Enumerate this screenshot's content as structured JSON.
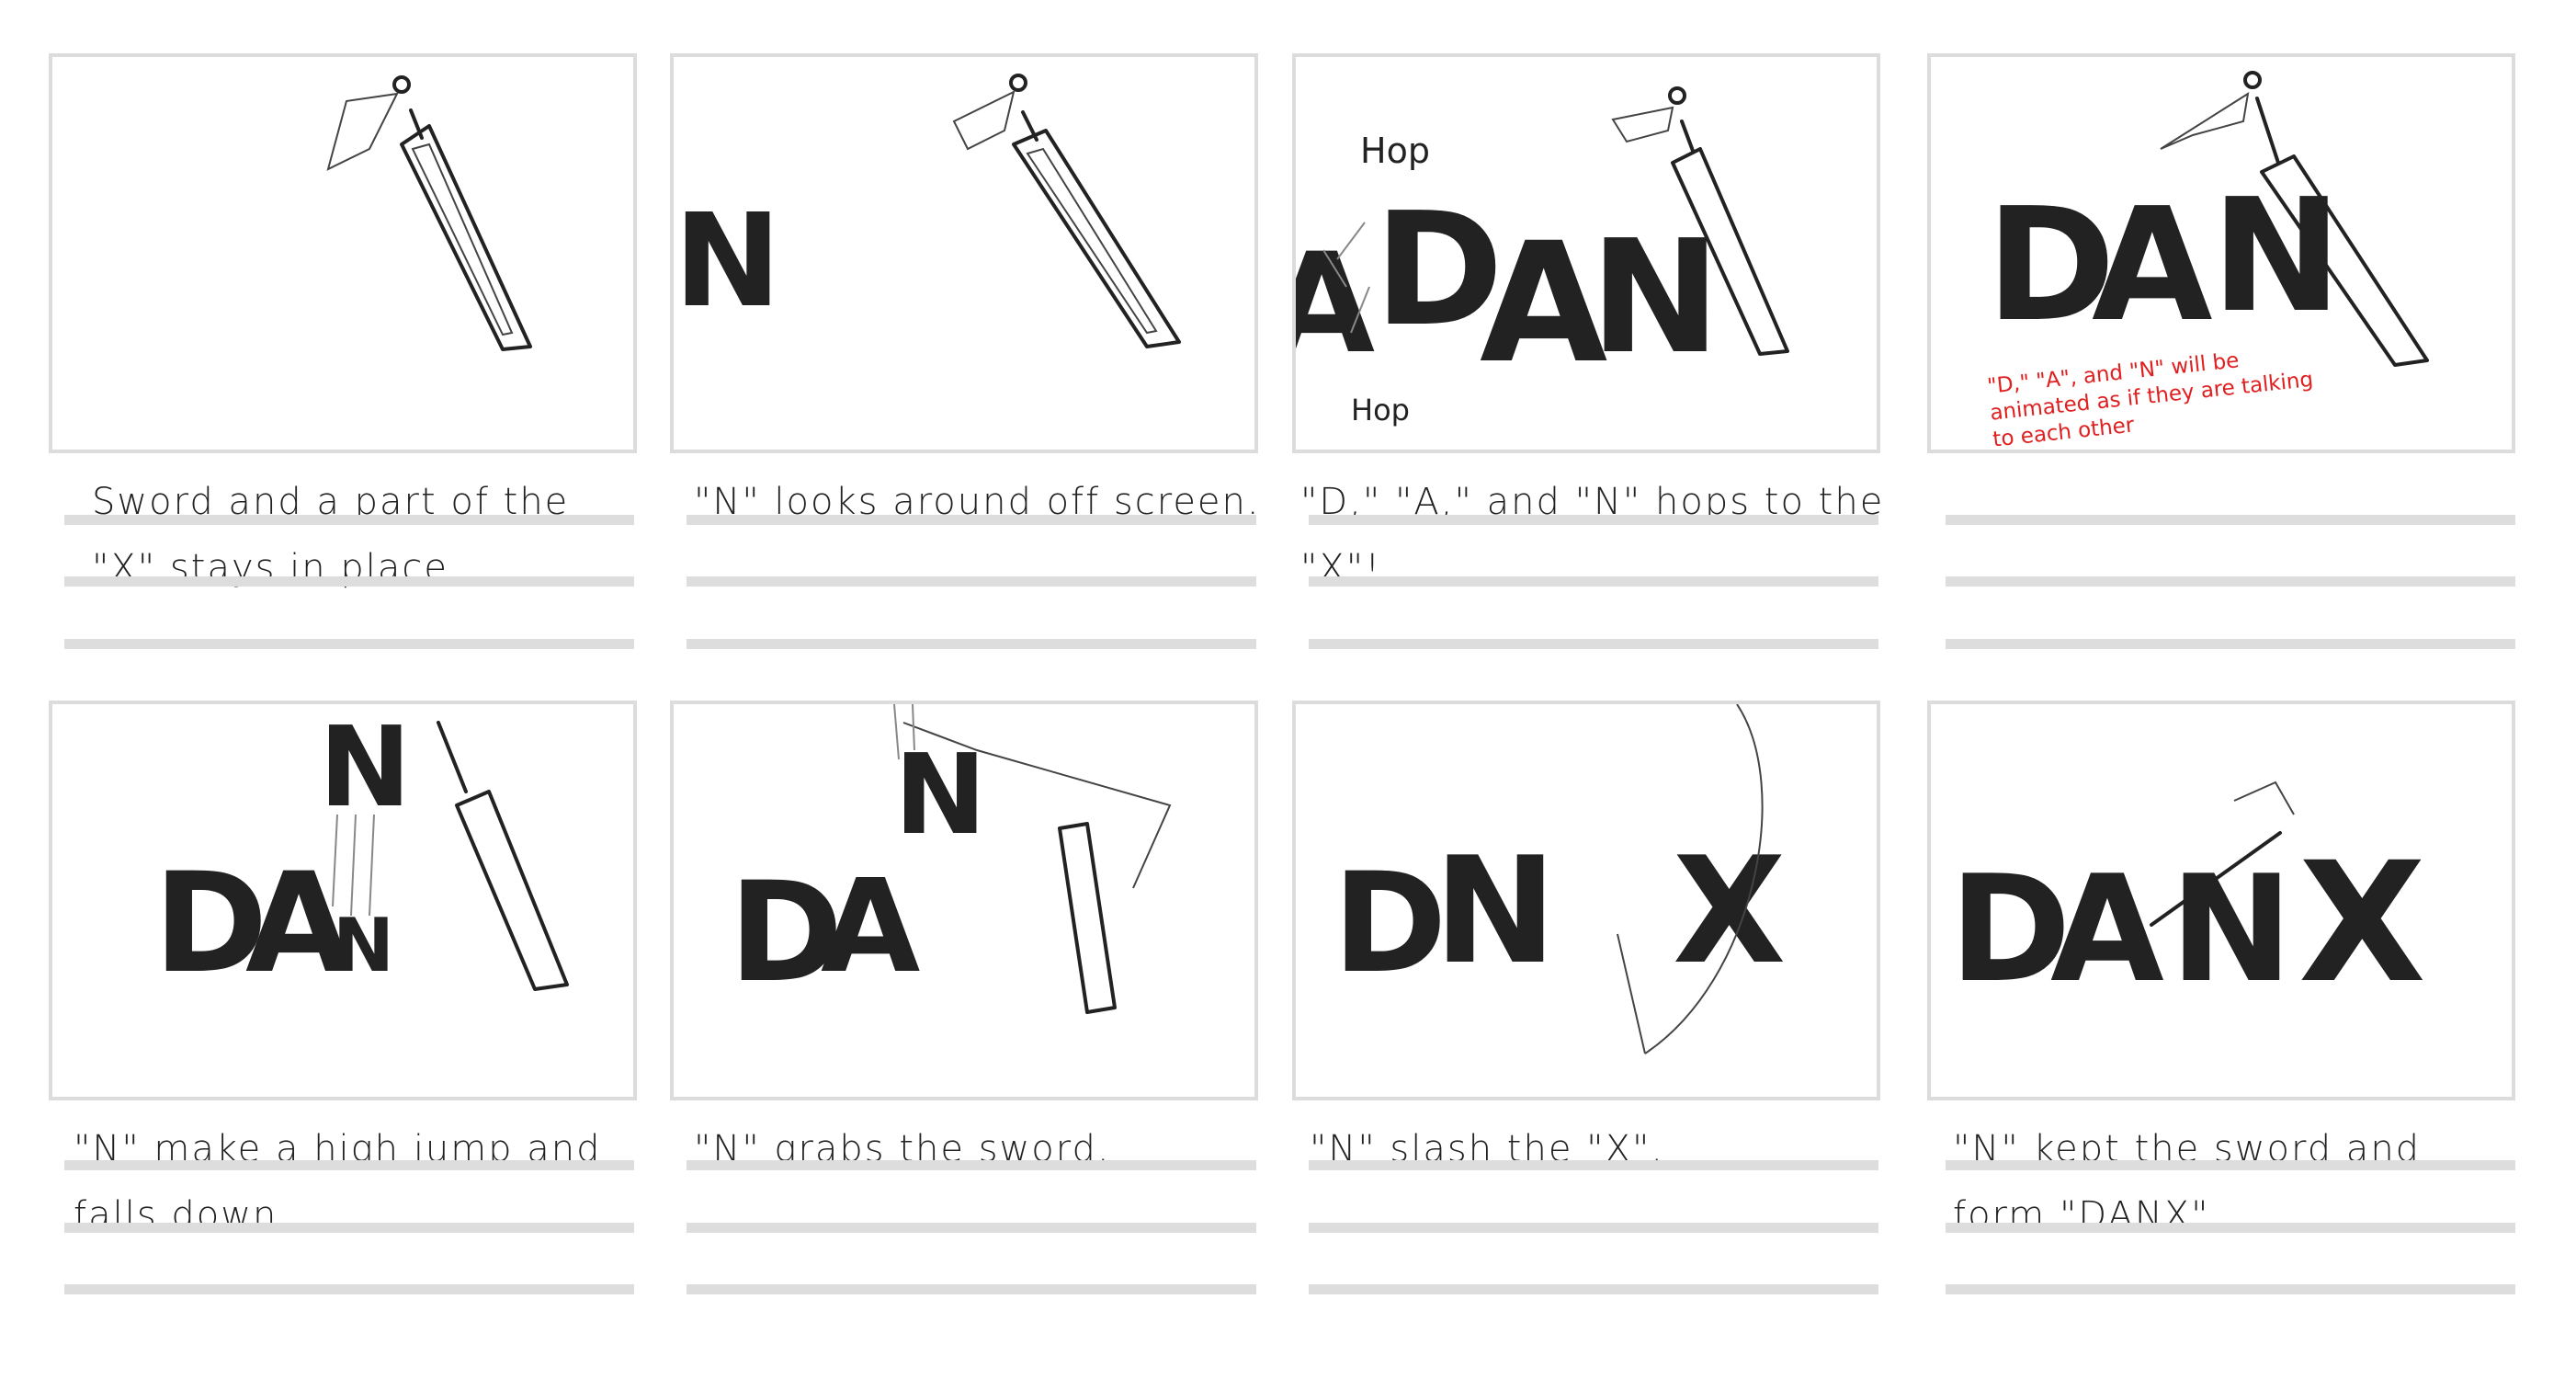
{
  "panels": [
    {
      "caption_line1": "Sword and a part of the",
      "caption_line2": "\"X\" stays in place."
    },
    {
      "caption_line1": "\"N\" looks around off screen.",
      "caption_line2": ""
    },
    {
      "caption_line1": "\"D,\" \"A,\" and \"N\" hops to the \"X\"!",
      "caption_line2": "",
      "sfx_top": "Hop",
      "sfx_bottom": "Hop"
    },
    {
      "caption_line1": "",
      "caption_line2": "",
      "note": "\"D,\" \"A\", and \"N\" will be animated as if they are talking to each other"
    },
    {
      "caption_line1": "\"N\" make a high jump and",
      "caption_line2": "falls down."
    },
    {
      "caption_line1": "\"N\" grabs the sword.",
      "caption_line2": ""
    },
    {
      "caption_line1": "\"N\" slash the \"X\".",
      "caption_line2": ""
    },
    {
      "caption_line1": "\"N\" kept the sword and",
      "caption_line2": "form \"DANX\""
    }
  ],
  "letters": {
    "d": "D",
    "a": "A",
    "n": "N",
    "x": "X"
  },
  "colors": {
    "border": "#dcdcdc",
    "rule": "#dddddd",
    "ink": "#222222",
    "note": "#e02020"
  }
}
